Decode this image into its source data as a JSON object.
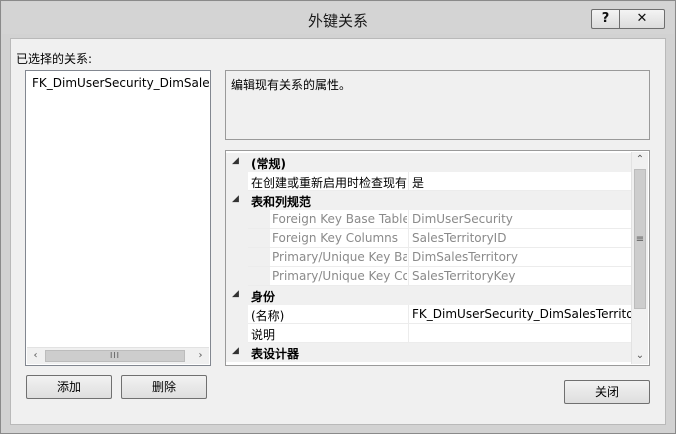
{
  "window": {
    "title": "外键关系",
    "help_label": "?",
    "close_label": "✕"
  },
  "left": {
    "selected_label": "已选择的关系:",
    "relationships": [
      "FK_DimUserSecurity_DimSalesTer"
    ],
    "hscroll": {
      "left": "‹",
      "thumb": "III",
      "right": "›"
    }
  },
  "buttons": {
    "add": "添加",
    "delete": "删除",
    "close": "关闭"
  },
  "description": "编辑现有关系的属性。",
  "grid": {
    "caret": "◢",
    "scroll": {
      "up": "⌃",
      "thumb": "≡",
      "down": "⌄"
    },
    "rows": [
      {
        "type": "category",
        "name": "(常规)"
      },
      {
        "type": "property",
        "level": 1,
        "name": "在创建或重新启用时检查现有",
        "value": "是",
        "dim": false
      },
      {
        "type": "category",
        "name": "表和列规范"
      },
      {
        "type": "property",
        "level": 2,
        "name": "Foreign Key Base Table",
        "value": "DimUserSecurity",
        "dim": true
      },
      {
        "type": "property",
        "level": 2,
        "name": "Foreign Key Columns",
        "value": "SalesTerritoryID",
        "dim": true
      },
      {
        "type": "property",
        "level": 2,
        "name": "Primary/Unique Key Base",
        "value": "DimSalesTerritory",
        "dim": true
      },
      {
        "type": "property",
        "level": 2,
        "name": "Primary/Unique Key Colu",
        "value": "SalesTerritoryKey",
        "dim": true
      },
      {
        "type": "category",
        "name": "身份"
      },
      {
        "type": "property",
        "level": 1,
        "name": "(名称)",
        "value": "FK_DimUserSecurity_DimSalesTerritory",
        "dim": false
      },
      {
        "type": "property",
        "level": 1,
        "name": "说明",
        "value": "",
        "dim": false
      },
      {
        "type": "category",
        "name": "表设计器"
      }
    ]
  }
}
